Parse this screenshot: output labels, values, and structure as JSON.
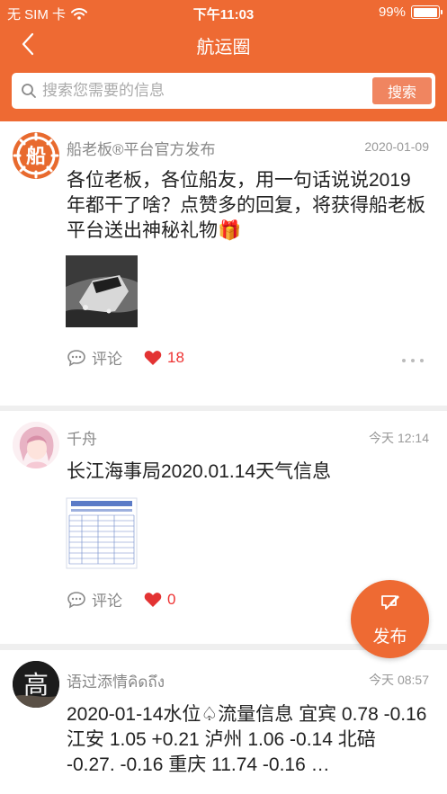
{
  "status_bar": {
    "carrier": "无 SIM 卡",
    "time": "下午11:03",
    "battery": "99%",
    "battery_level": 0.99
  },
  "nav": {
    "title": "航运圈"
  },
  "search": {
    "placeholder": "搜索您需要的信息",
    "button": "搜索"
  },
  "posts": [
    {
      "author": "船老板®平台官方发布",
      "avatar_text": "船",
      "date": "2020-01-09",
      "content": "各位老板，各位船友，用一句话说说2019年都干了啥？点赞多的回复，将获得船老板平台送出神秘礼物🎁",
      "comment_label": "评论",
      "likes": "18"
    },
    {
      "author": "千舟",
      "date": "今天 12:14",
      "content": "长江海事局2020.01.14天气信息",
      "comment_label": "评论",
      "likes": "0"
    },
    {
      "author": "语过添情คิดถึง",
      "avatar_text": "高",
      "date": "今天 08:57",
      "content": "2020-01-14水位♤流量信息 宜宾 0.78 -0.16 江安 1.05 +0.21 泸州 1.06 -0.14 北碚 -0.27. -0.16 重庆 11.74 -0.16 …"
    }
  ],
  "fab": {
    "label": "发布"
  },
  "colors": {
    "brand": "#ee6a33",
    "like": "#e33333"
  }
}
